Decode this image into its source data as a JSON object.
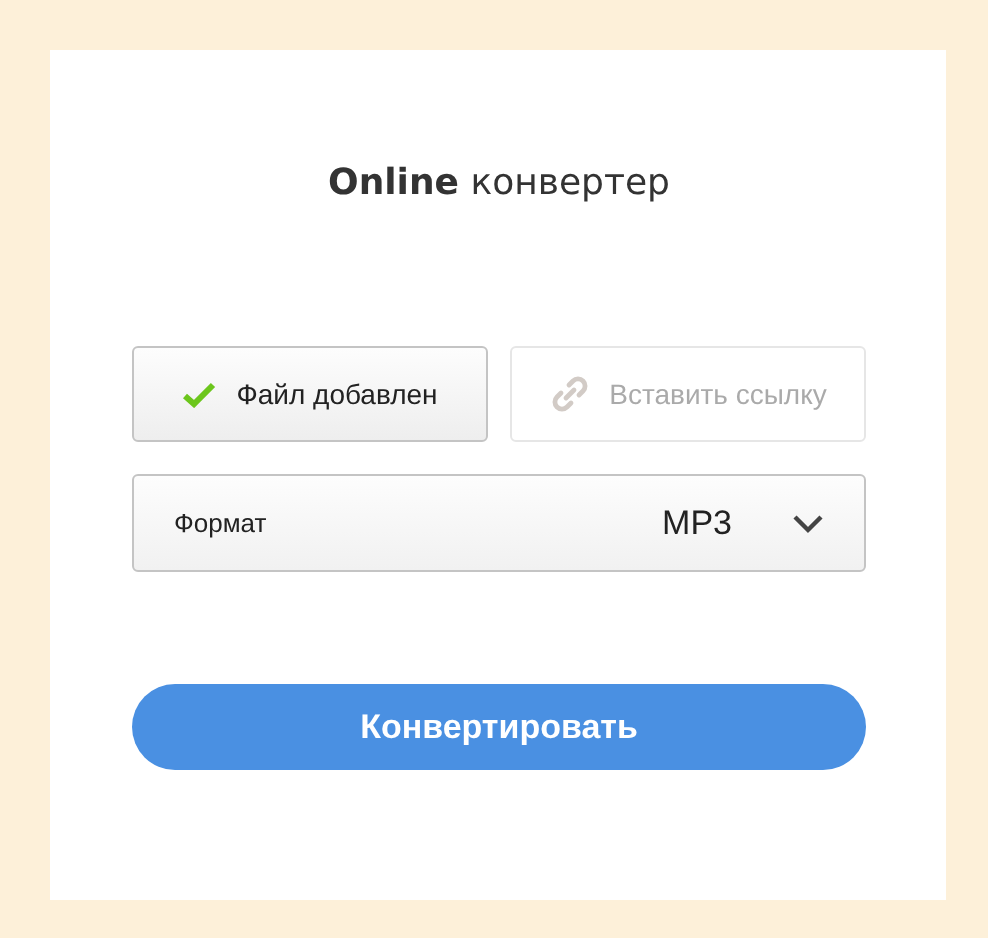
{
  "title": "**Online** конвертер",
  "sources": [
    {
      "label": "Файл добавлен",
      "kind": "file",
      "done": true,
      "disabled": false
    },
    {
      "label": "Вставить ссылку",
      "kind": "link",
      "done": false,
      "disabled": true
    }
  ],
  "format": {
    "label": "Формат",
    "value": "MP3"
  },
  "convert_button": "Конвертировать"
}
